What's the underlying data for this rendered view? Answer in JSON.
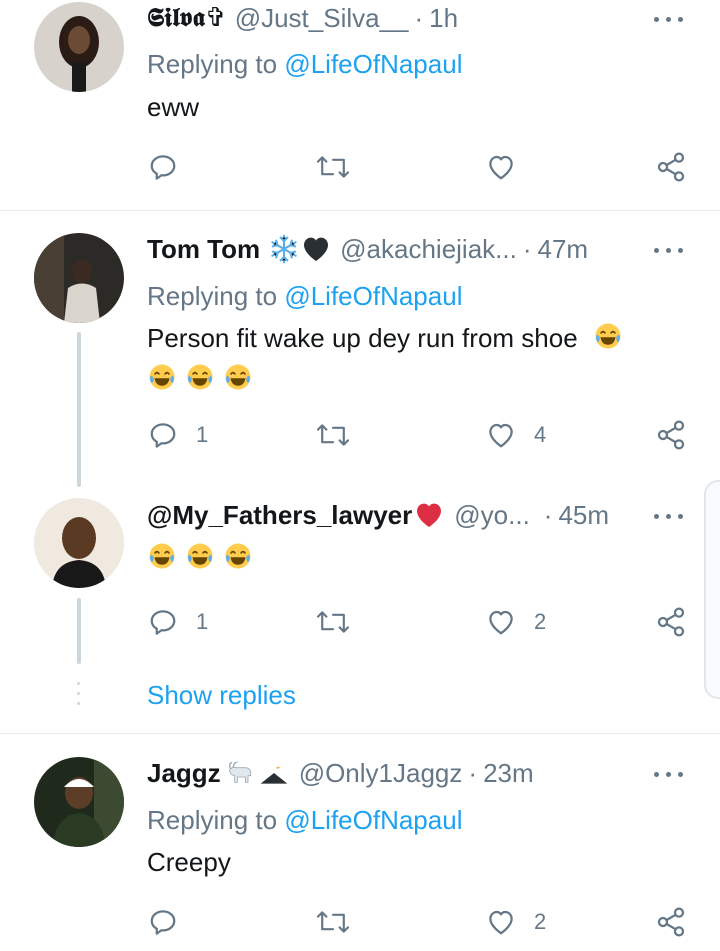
{
  "tweets": [
    {
      "name": "𝕾𝖎𝖑𝖛𝖆✞",
      "handle": "@Just_Silva__",
      "separator": "·",
      "time": "1h",
      "replying_prefix": "Replying to",
      "replying_to": "@LifeOfNapaul",
      "text": "eww",
      "reply_count": "",
      "like_count": ""
    },
    {
      "name": "Tom Tom",
      "name_emojis": [
        "snowflake-icon",
        "black-heart-icon"
      ],
      "handle": "@akachiejiak...",
      "separator": "·",
      "time": "47m",
      "replying_prefix": "Replying to",
      "replying_to": "@LifeOfNapaul",
      "text": "Person fit wake up dey run from shoe",
      "text_emojis": [
        "laughing-tears-icon",
        "laughing-tears-icon",
        "laughing-tears-icon",
        "laughing-tears-icon"
      ],
      "reply_count": "1",
      "like_count": "4"
    },
    {
      "name": "@My_Fathers_lawyer",
      "name_emojis": [
        "red-heart-icon"
      ],
      "handle": "@yo...",
      "separator": "·",
      "time": "45m",
      "text_emojis": [
        "laughing-tears-icon",
        "laughing-tears-icon",
        "laughing-tears-icon"
      ],
      "reply_count": "1",
      "like_count": "2"
    },
    {
      "name": "Jaggz",
      "name_emojis": [
        "goat-icon",
        "eagle-icon"
      ],
      "handle": "@Only1Jaggz",
      "separator": "·",
      "time": "23m",
      "replying_prefix": "Replying to",
      "replying_to": "@LifeOfNapaul",
      "text": "Creepy",
      "reply_count": "",
      "like_count": "2"
    }
  ],
  "show_replies_label": "Show replies",
  "colors": {
    "accent": "#1da1f2",
    "secondary_text": "#657786",
    "primary_text": "#14171a",
    "divider": "#e6ecf0",
    "heart_red": "#e0245e"
  }
}
